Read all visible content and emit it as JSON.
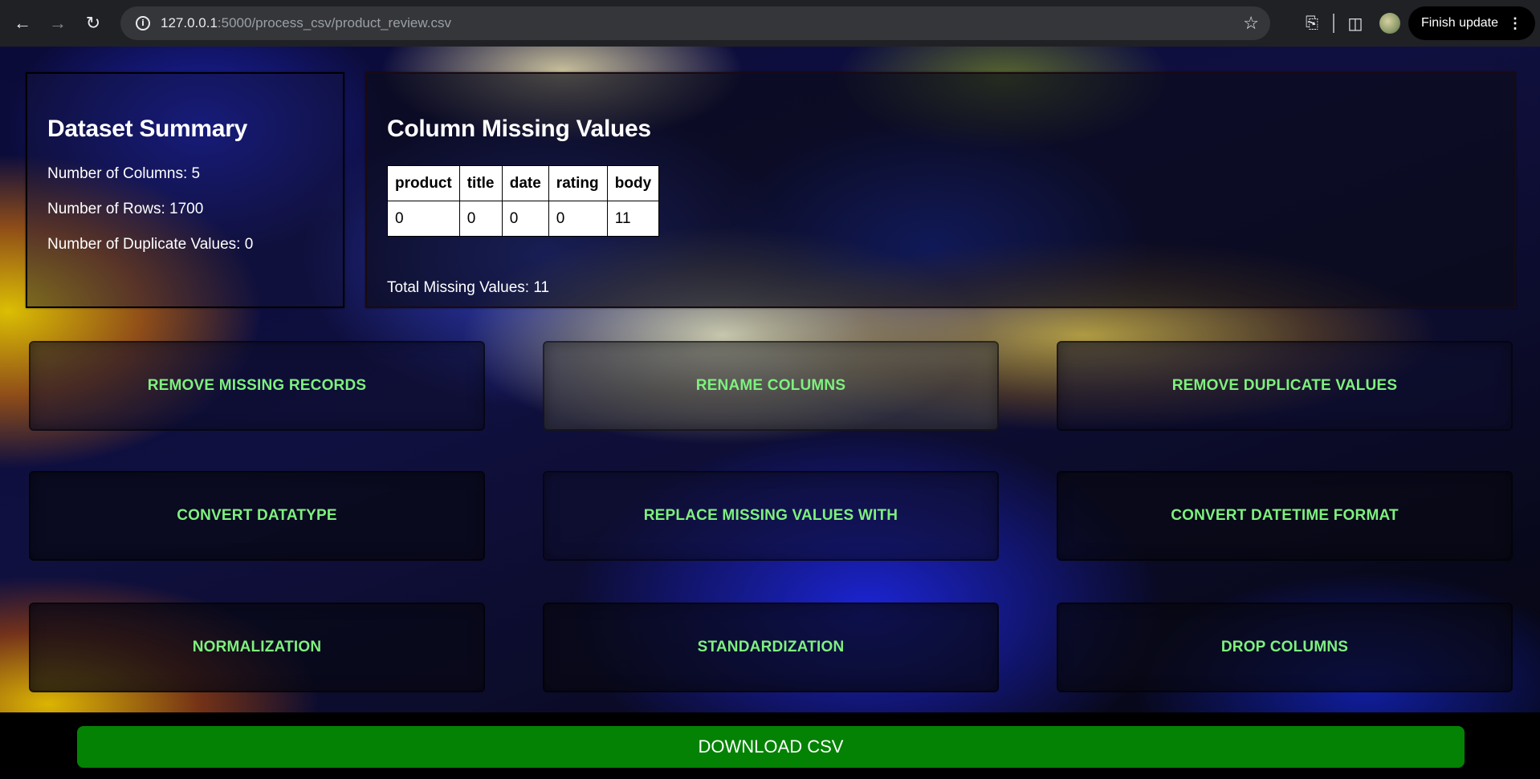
{
  "browser": {
    "url_host": "127.0.0.1",
    "url_path": ":5000/process_csv/product_review.csv",
    "update_label": "Finish update"
  },
  "summary": {
    "title": "Dataset Summary",
    "columns": "Number of Columns: 5",
    "rows": "Number of Rows: 1700",
    "duplicates": "Number of Duplicate Values: 0"
  },
  "missing": {
    "title": "Column Missing Values",
    "headers": [
      "product",
      "title",
      "date",
      "rating",
      "body"
    ],
    "values": [
      "0",
      "0",
      "0",
      "0",
      "11"
    ],
    "total": "Total Missing Values: 11"
  },
  "actions": {
    "remove_missing": "REMOVE MISSING RECORDS",
    "rename_columns": "RENAME COLUMNS",
    "remove_duplicates": "REMOVE DUPLICATE VALUES",
    "convert_datatype": "CONVERT DATATYPE",
    "replace_missing": "REPLACE MISSING VALUES WITH",
    "convert_datetime": "CONVERT DATETIME FORMAT",
    "normalization": "NORMALIZATION",
    "standardization": "STANDARDIZATION",
    "drop_columns": "DROP COLUMNS"
  },
  "download_label": "DOWNLOAD CSV",
  "colors": {
    "button_text": "#7ef07e",
    "download_bg": "#048204",
    "chrome_bg": "#202124"
  }
}
